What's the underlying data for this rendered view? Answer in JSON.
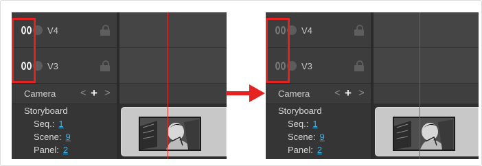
{
  "colors": {
    "highlight": "#e52121",
    "arrow": "#e52121",
    "link": "#36b7e8",
    "playhead": "#e03030"
  },
  "panels": [
    {
      "state": "before",
      "layers": [
        {
          "name": "V4",
          "eye": "eye-visible-icon"
        },
        {
          "name": "V3",
          "eye": "eye-visible-icon"
        }
      ],
      "camera": {
        "label": "Camera",
        "prev": "<",
        "add": "+",
        "next": ">"
      },
      "storyboard": {
        "title": "Storyboard",
        "seq_label": "Seq.:",
        "seq_value": "1",
        "scene_label": "Scene:",
        "scene_value": "9",
        "panel_label": "Panel:",
        "panel_value": "2"
      }
    },
    {
      "state": "after",
      "layers": [
        {
          "name": "V4",
          "eye": "eye-hidden-icon"
        },
        {
          "name": "V3",
          "eye": "eye-hidden-icon"
        }
      ],
      "camera": {
        "label": "Camera",
        "prev": "<",
        "add": "+",
        "next": ">"
      },
      "storyboard": {
        "title": "Storyboard",
        "seq_label": "Seq.:",
        "seq_value": "1",
        "scene_label": "Scene:",
        "scene_value": "9",
        "panel_label": "Panel:",
        "panel_value": "2"
      }
    }
  ]
}
